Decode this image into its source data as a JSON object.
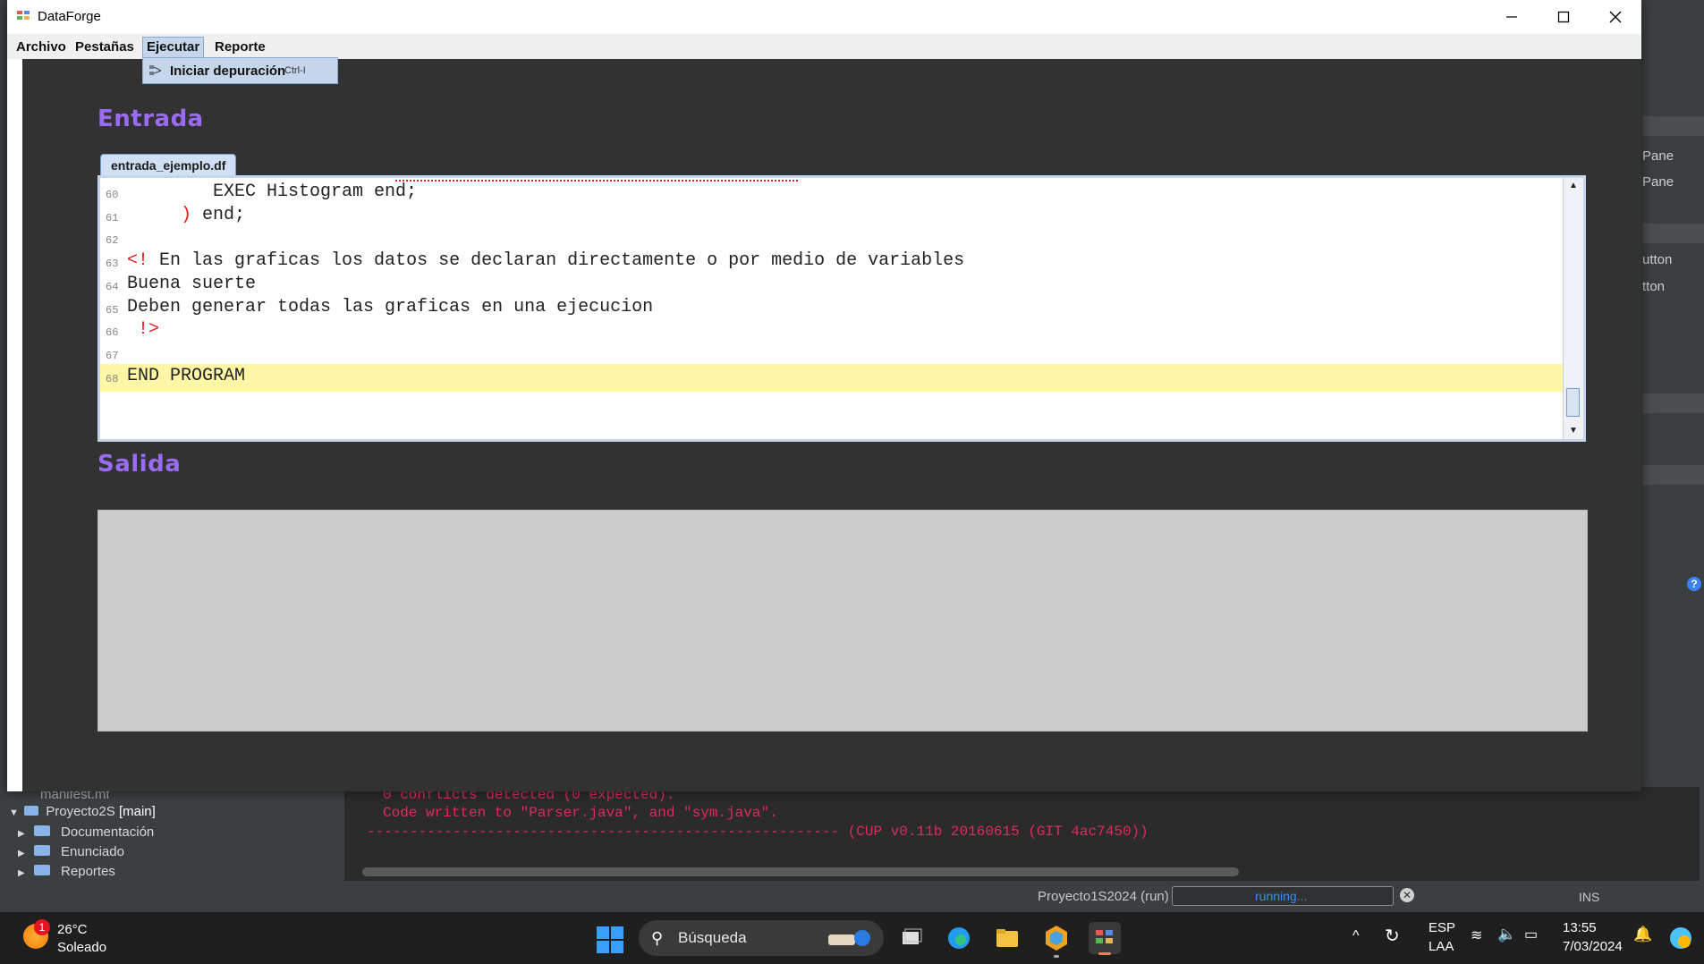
{
  "window": {
    "title": "DataForge"
  },
  "menubar": {
    "items": [
      "Archivo",
      "Pestañas",
      "Ejecutar",
      "Reporte"
    ],
    "dropdown": {
      "label": "Iniciar depuración",
      "accelerator": "Ctrl-I"
    }
  },
  "input_section": {
    "title": "Entrada",
    "tab_label": "entrada_ejemplo.df"
  },
  "editor": {
    "lines": [
      {
        "num": "60",
        "text": "        EXEC Histogram end;"
      },
      {
        "num": "61",
        "pre": "     ",
        "red": ")",
        "text": " end;"
      },
      {
        "num": "62",
        "text": ""
      },
      {
        "num": "63",
        "red": "<!",
        "text": " En las graficas los datos se declaran directamente o por medio de variables"
      },
      {
        "num": "64",
        "text": "Buena suerte"
      },
      {
        "num": "65",
        "text": "Deben generar todas las graficas en una ejecucion"
      },
      {
        "num": "66",
        "red": " !>",
        "text": ""
      },
      {
        "num": "67",
        "text": ""
      },
      {
        "num": "68",
        "text": "END PROGRAM"
      }
    ]
  },
  "output_section": {
    "title": "Salida"
  },
  "background_ide": {
    "right_labels": [
      "Pane",
      "Pane",
      "utton",
      "tton"
    ],
    "project_tree": [
      {
        "label": "manifest.mf"
      },
      {
        "label": "Proyecto2S",
        "branch": "[main]"
      },
      {
        "label": "Documentación"
      },
      {
        "label": "Enunciado"
      },
      {
        "label": "Reportes"
      }
    ],
    "console_lines": [
      "0 conflicts detected (0 expected).",
      "Code written to \"Parser.java\", and \"sym.java\".",
      "------------------------------------------------------- (CUP v0.11b 20160615 (GIT 4ac7450))"
    ],
    "status": {
      "run_label": "Proyecto1S2024 (run)",
      "progress_text": "running...",
      "mode": "INS"
    }
  },
  "taskbar": {
    "weather": {
      "temp": "26°C",
      "condition": "Soleado",
      "badge": "1"
    },
    "search_placeholder": "Búsqueda",
    "tray": {
      "lang_top": "ESP",
      "lang_bottom": "LAA",
      "time": "13:55",
      "date": "7/03/2024"
    }
  },
  "colors": {
    "accent_title": "#9b6bf5",
    "highlight_line": "#fff7a6",
    "menu_active": "#c5d6ea",
    "console_text": "#e02a5a"
  }
}
